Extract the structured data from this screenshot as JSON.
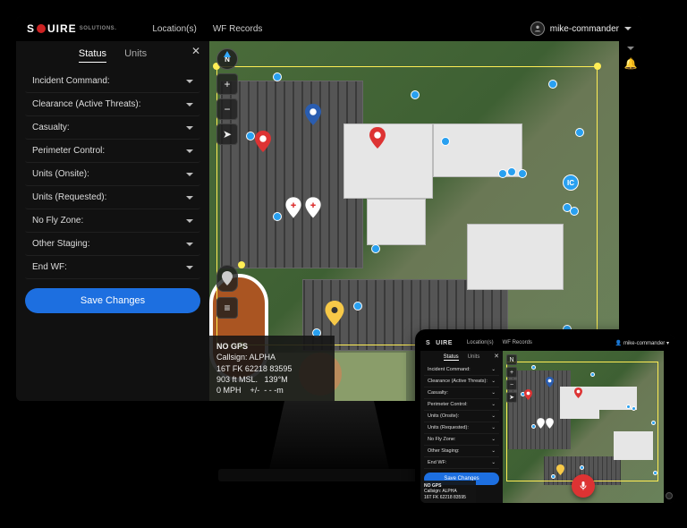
{
  "brand": {
    "name": "SQUIRE",
    "sub": "SOLUTIONS."
  },
  "nav": {
    "locations": "Location(s)",
    "wf_records": "WF Records"
  },
  "user": {
    "name": "mike-commander"
  },
  "sidebar": {
    "tabs": {
      "status": "Status",
      "units": "Units"
    },
    "items": [
      {
        "label": "Incident Command:"
      },
      {
        "label": "Clearance (Active Threats):"
      },
      {
        "label": "Casualty:"
      },
      {
        "label": "Perimeter Control:"
      },
      {
        "label": "Units (Onsite):"
      },
      {
        "label": "Units (Requested):"
      },
      {
        "label": "No Fly Zone:"
      },
      {
        "label": "Other Staging:"
      },
      {
        "label": "End WF:"
      }
    ],
    "save": "Save Changes"
  },
  "gps": {
    "title": "NO GPS",
    "callsign_label": "Callsign:",
    "callsign": "ALPHA",
    "mgrs": "16T FK 62218 83595",
    "alt": "903 ft MSL.",
    "heading": "139°M",
    "speed": "0 MPH",
    "accuracy": "+/-  - - -m"
  },
  "map": {
    "ic_label": "IC",
    "compass": "N"
  }
}
